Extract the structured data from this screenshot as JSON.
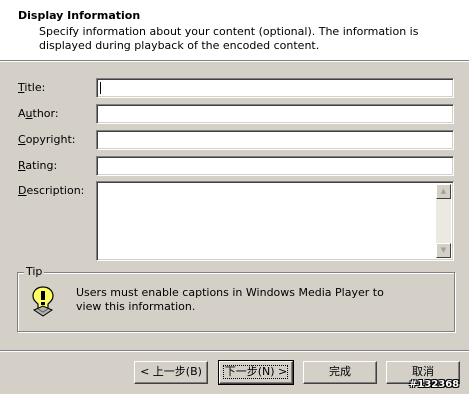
{
  "header": {
    "title": "Display Information",
    "description": "Specify information about your content (optional). The information is displayed during playback of the encoded content."
  },
  "fields": [
    {
      "label_accel": "T",
      "label_rest": "itle:",
      "value": ""
    },
    {
      "label_accel": "",
      "label_pre": "A",
      "label_accel2": "u",
      "label_rest": "thor:",
      "value": ""
    },
    {
      "label_accel": "C",
      "label_rest": "opyright:",
      "value": ""
    },
    {
      "label_accel": "R",
      "label_rest": "ating:",
      "value": ""
    }
  ],
  "description_field": {
    "label_accel": "D",
    "label_rest": "escription:",
    "value": ""
  },
  "tip": {
    "legend": "Tip",
    "icon": "lightbulb-tip-icon",
    "text": "Users must enable captions in Windows Media Player to view this information."
  },
  "buttons": {
    "back": "< 上一步(B)",
    "next": "下一步(N) >",
    "finish": "完成",
    "cancel": "取消"
  },
  "watermark": "#132368"
}
